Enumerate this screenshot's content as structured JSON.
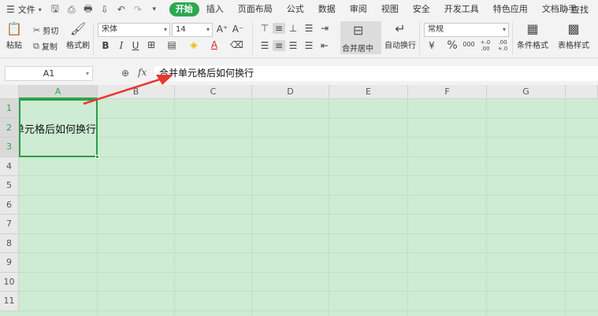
{
  "menu": {
    "file_label": "文件",
    "tabs": [
      "开始",
      "插入",
      "页面布局",
      "公式",
      "数据",
      "审阅",
      "视图",
      "安全",
      "开发工具",
      "特色应用",
      "文档助手"
    ],
    "active_tab": "开始",
    "search_label": "查找"
  },
  "ribbon": {
    "paste": "粘贴",
    "cut": "剪切",
    "copy": "复制",
    "format_painter": "格式刷",
    "font_name": "宋体",
    "font_size": "14",
    "merge_center": "合并居中",
    "auto_wrap": "自动换行",
    "number_format": "常规",
    "conditional_format": "条件格式",
    "table_style": "表格样式",
    "bold": "B",
    "italic": "I",
    "underline": "U",
    "percent": "%",
    "thousands": "000",
    "inc_decimal": "+.0 .00",
    "dec_decimal": ".00 +.0"
  },
  "formula_bar": {
    "cell_ref": "A1",
    "fx": "fx",
    "content": "合并单元格后如何换行"
  },
  "grid": {
    "columns": [
      "A",
      "B",
      "C",
      "D",
      "E",
      "F",
      "G"
    ],
    "rows": [
      "1",
      "2",
      "3",
      "4",
      "5",
      "6",
      "7",
      "8",
      "9",
      "10",
      "11"
    ],
    "merged_cell_text": "合并单元格后如何换行"
  },
  "colors": {
    "accent": "#2ca84f",
    "sheet_bg": "#cdecd3",
    "selection_border": "#2b9d45",
    "arrow": "#e8382f"
  }
}
